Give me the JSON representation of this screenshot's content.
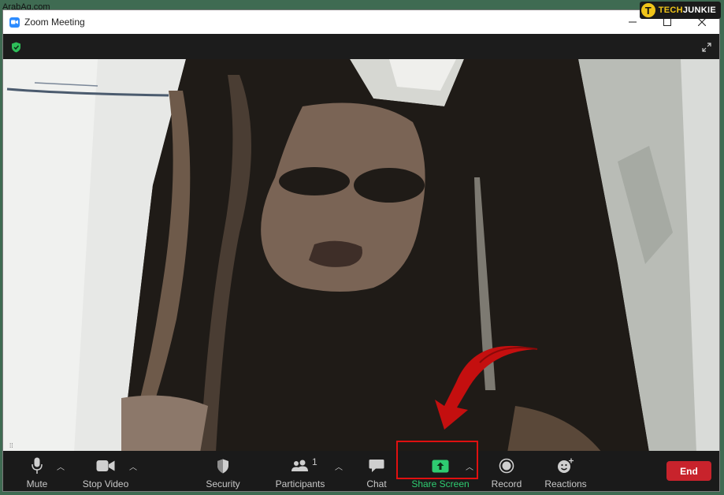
{
  "watermark": "ArabAq.com",
  "logo": {
    "letter": "T",
    "text_a": "TECH",
    "text_b": "JUNKIE"
  },
  "window": {
    "title": "Zoom Meeting"
  },
  "toolbar": {
    "mute": {
      "label": "Mute",
      "icon": "microphone-icon"
    },
    "stop_video": {
      "label": "Stop Video",
      "icon": "camera-icon"
    },
    "security": {
      "label": "Security",
      "icon": "shield-icon"
    },
    "participants": {
      "label": "Participants",
      "count": "1",
      "icon": "people-icon"
    },
    "chat": {
      "label": "Chat",
      "icon": "chat-bubble-icon"
    },
    "share_screen": {
      "label": "Share Screen",
      "icon": "share-arrow-up-icon"
    },
    "record": {
      "label": "Record",
      "icon": "record-icon"
    },
    "reactions": {
      "label": "Reactions",
      "icon": "smile-plus-icon"
    },
    "end": {
      "label": "End"
    }
  },
  "colors": {
    "share_green": "#2ecc71",
    "end_red": "#c8232c",
    "highlight_red": "#e01010",
    "toolbar_bg": "#1a1a1a"
  }
}
